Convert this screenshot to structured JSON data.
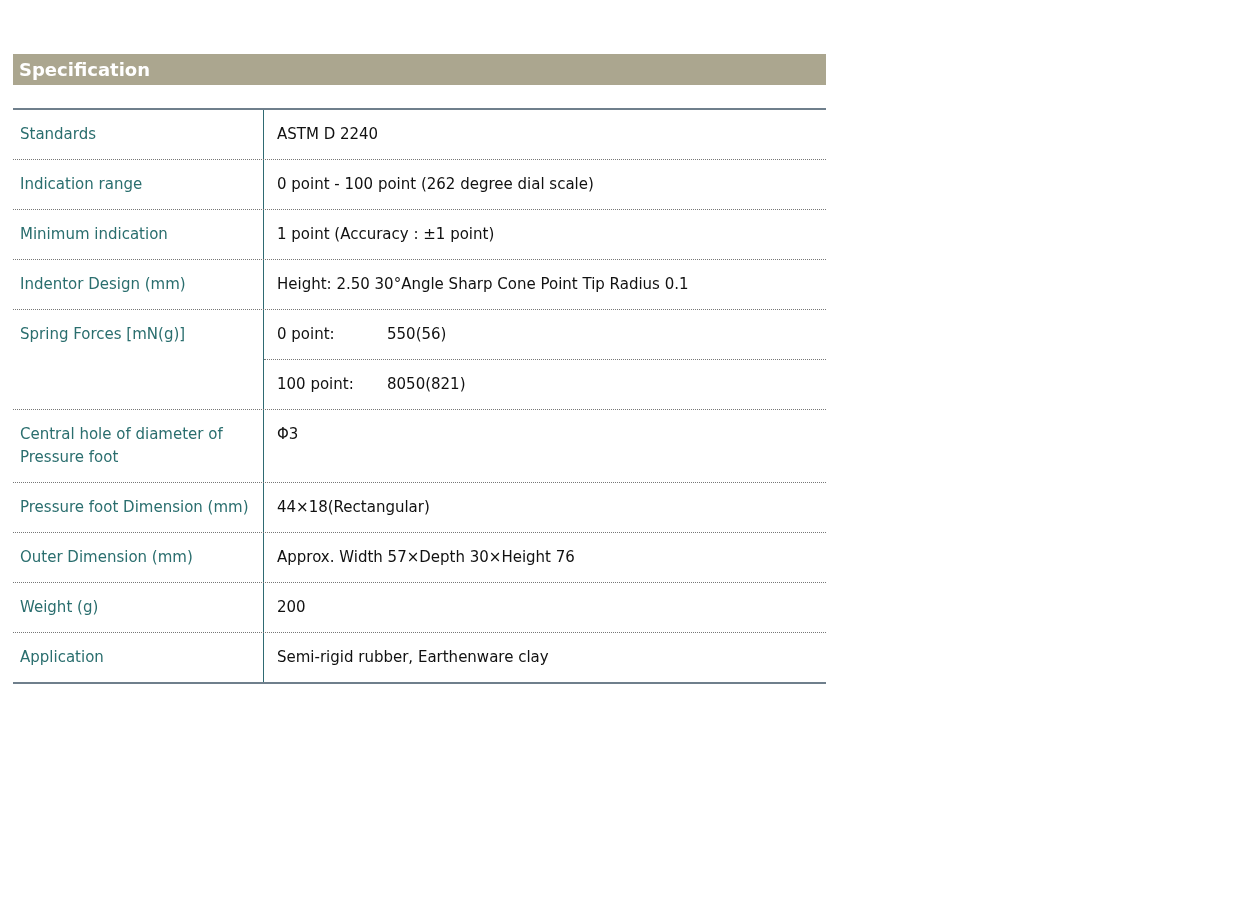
{
  "section": {
    "title": "Specification"
  },
  "rows": [
    {
      "label": "Standards",
      "lines": [
        [
          "ASTM D 2240"
        ]
      ]
    },
    {
      "label": "Indication range",
      "lines": [
        [
          "0 point - 100 point (262 degree dial scale)"
        ]
      ]
    },
    {
      "label": "Minimum indication",
      "lines": [
        [
          "1 point (Accuracy : ±1 point)"
        ]
      ]
    },
    {
      "label": "Indentor Design (mm)",
      "lines": [
        [
          "Height: 2.50 30°Angle Sharp Cone Point Tip Radius 0.1"
        ]
      ]
    },
    {
      "label": "Spring Forces [mN(g)]",
      "lines": [
        [
          "0 point:",
          "550(56)"
        ],
        [
          "100 point:",
          "8050(821)"
        ]
      ]
    },
    {
      "label": "Central hole of diameter of Pressure foot",
      "lines": [
        [
          "Φ3"
        ]
      ]
    },
    {
      "label": "Pressure foot Dimension (mm)",
      "lines": [
        [
          "44×18(Rectangular)"
        ]
      ]
    },
    {
      "label": "Outer Dimension (mm)",
      "lines": [
        [
          "Approx. Width 57×Depth 30×Height 76"
        ]
      ]
    },
    {
      "label": "Weight (g)",
      "lines": [
        [
          "200"
        ]
      ]
    },
    {
      "label": "Application",
      "lines": [
        [
          "Semi-rigid rubber, Earthenware clay"
        ]
      ]
    }
  ]
}
